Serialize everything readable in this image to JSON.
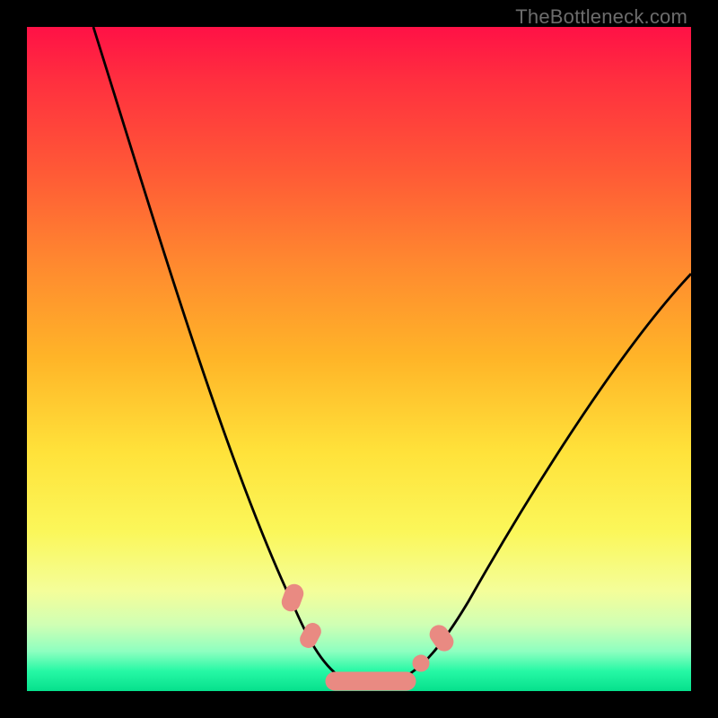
{
  "watermark_text": "TheBottleneck.com",
  "colors": {
    "frame_bg": "#000000",
    "curve_stroke": "#000000",
    "marker_fill": "#e98a82",
    "marker_stroke": "#e98a82"
  },
  "chart_data": {
    "type": "line",
    "title": "",
    "xlabel": "",
    "ylabel": "",
    "xlim": [
      0,
      100
    ],
    "ylim": [
      0,
      100
    ],
    "grid": false,
    "note": "No numeric axis labels are visible. Values below are pixel-normalized 0-100 estimates read off the image (x left→right, y bottom→top).",
    "series": [
      {
        "name": "bottleneck-curve",
        "x": [
          10,
          14,
          18,
          22,
          26,
          30,
          34,
          38,
          40,
          42,
          44,
          46,
          49,
          52,
          55,
          58,
          60,
          63,
          66,
          70,
          75,
          80,
          85,
          90,
          95,
          100
        ],
        "y": [
          100,
          88,
          76,
          64,
          52,
          41,
          31,
          21,
          16,
          11,
          7,
          4,
          2,
          1,
          1,
          2,
          3,
          5,
          9,
          14,
          22,
          31,
          40,
          49,
          57,
          63
        ]
      }
    ],
    "markers": [
      {
        "name": "segment-left-upper",
        "shape": "pill",
        "x": 39.5,
        "y": 13.5,
        "angle": -68
      },
      {
        "name": "segment-left-lower",
        "shape": "pill",
        "x": 42.5,
        "y": 8.0,
        "angle": -62
      },
      {
        "name": "segment-bottom",
        "shape": "long-pill",
        "x": 51.5,
        "y": 1.5,
        "angle": 0
      },
      {
        "name": "dot-right-lower",
        "shape": "dot",
        "x": 59.0,
        "y": 4.0
      },
      {
        "name": "segment-right",
        "shape": "pill",
        "x": 62.0,
        "y": 8.0,
        "angle": 55
      }
    ]
  }
}
